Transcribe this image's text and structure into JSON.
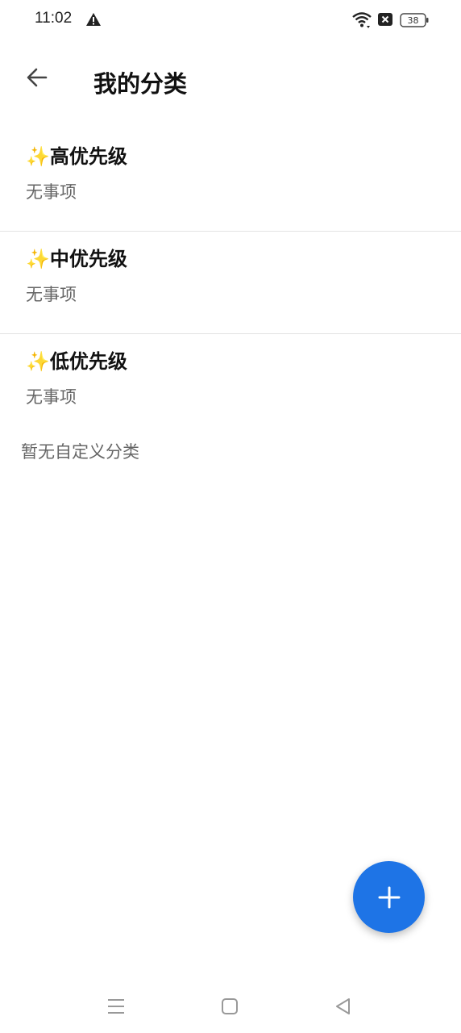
{
  "status_bar": {
    "time": "11:02",
    "battery_level": "38"
  },
  "header": {
    "title": "我的分类"
  },
  "categories": [
    {
      "icon": "✨",
      "name": "高优先级",
      "count_text": "无事项"
    },
    {
      "icon": "✨",
      "name": "中优先级",
      "count_text": "无事项"
    },
    {
      "icon": "✨",
      "name": "低优先级",
      "count_text": "无事项"
    }
  ],
  "custom_empty_text": "暂无自定义分类",
  "colors": {
    "accent": "#1e74e6",
    "sparkle": "#f2b600"
  }
}
